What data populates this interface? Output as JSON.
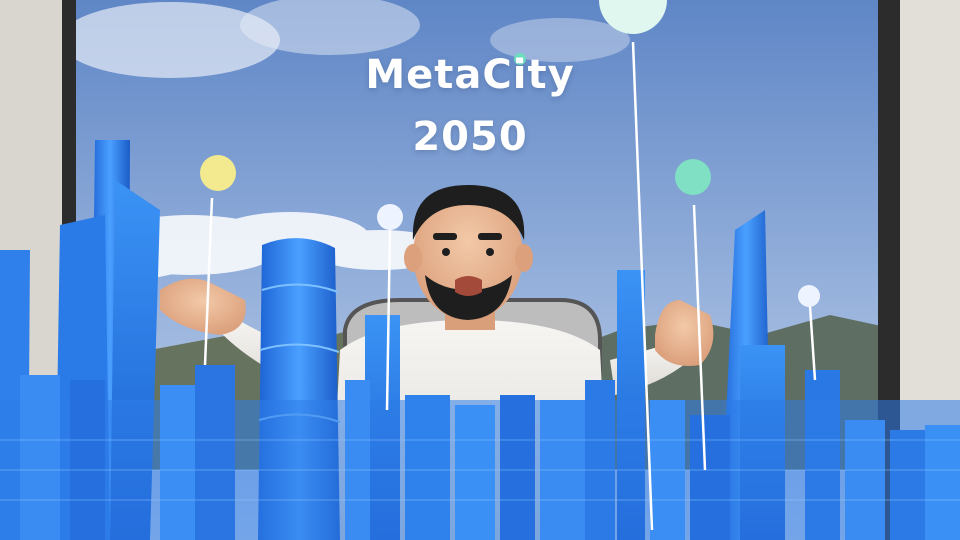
{
  "title": {
    "line1": "MetaCity",
    "line2": "2050"
  },
  "colors": {
    "sky_top": "#5f86c6",
    "sky_bottom": "#b9cbe6",
    "building_blue": "#2f7fe6",
    "building_dark": "#1758c2",
    "frame": "#d9d6cf",
    "pin_yellow": "#f3ea8f",
    "pin_mint": "#7fe0c3",
    "pin_white": "#eef4ff"
  }
}
